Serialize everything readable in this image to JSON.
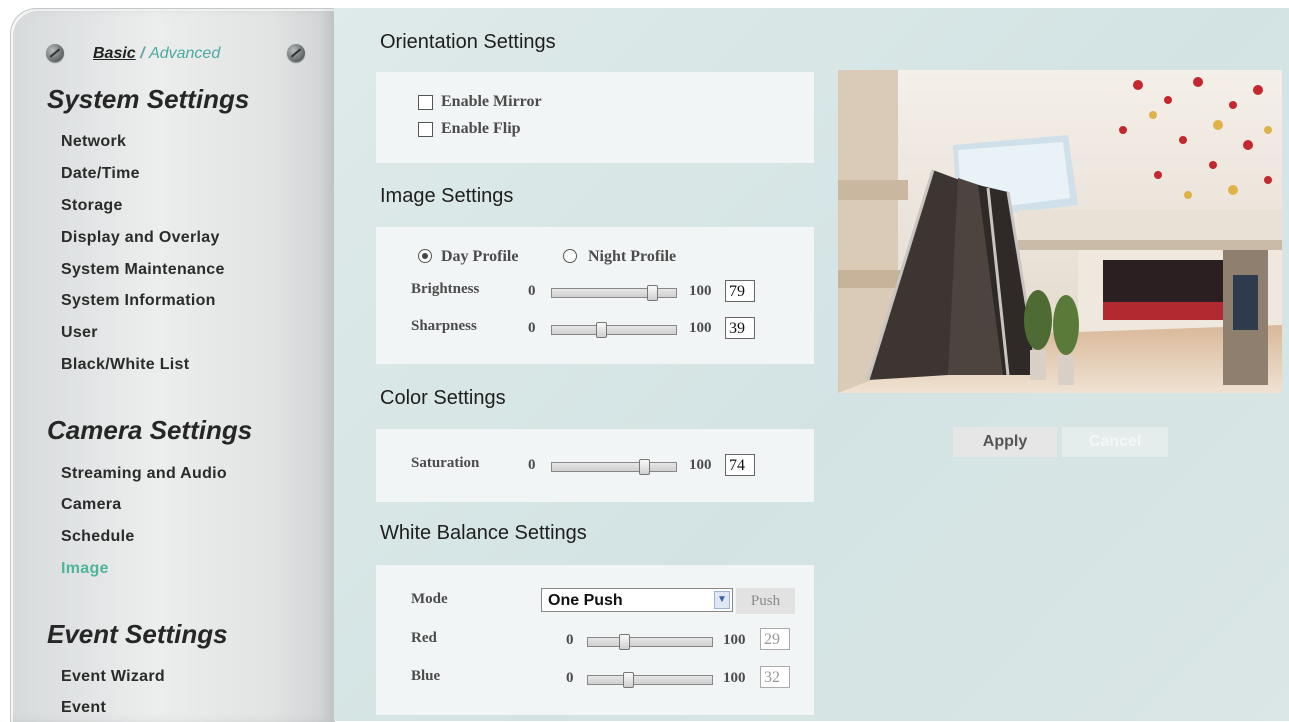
{
  "sidebar": {
    "mode_basic": "Basic",
    "mode_separator": "/",
    "mode_advanced": "Advanced",
    "system_settings": {
      "title": "System Settings",
      "items": [
        "Network",
        "Date/Time",
        "Storage",
        "Display and Overlay",
        "System Maintenance",
        "System Information",
        "User",
        "Black/White List"
      ]
    },
    "camera_settings": {
      "title": "Camera Settings",
      "items": [
        "Streaming and Audio",
        "Camera",
        "Schedule",
        "Image"
      ],
      "active": "Image"
    },
    "event_settings": {
      "title": "Event Settings",
      "items": [
        "Event Wizard",
        "Event"
      ]
    }
  },
  "orientation": {
    "title": "Orientation Settings",
    "enable_mirror": "Enable Mirror",
    "enable_mirror_checked": false,
    "enable_flip": "Enable Flip",
    "enable_flip_checked": false
  },
  "image": {
    "title": "Image Settings",
    "day_profile": "Day Profile",
    "night_profile": "Night Profile",
    "selected_profile": "Day Profile",
    "brightness": {
      "label": "Brightness",
      "min": "0",
      "max": "100",
      "value": "79"
    },
    "sharpness": {
      "label": "Sharpness",
      "min": "0",
      "max": "100",
      "value": "39"
    }
  },
  "color": {
    "title": "Color Settings",
    "saturation": {
      "label": "Saturation",
      "min": "0",
      "max": "100",
      "value": "74"
    }
  },
  "white_balance": {
    "title": "White Balance Settings",
    "mode_label": "Mode",
    "mode_value": "One Push",
    "push_label": "Push",
    "red": {
      "label": "Red",
      "min": "0",
      "max": "100",
      "value": "29"
    },
    "blue": {
      "label": "Blue",
      "min": "0",
      "max": "100",
      "value": "32"
    }
  },
  "actions": {
    "apply": "Apply",
    "cancel": "Cancel"
  },
  "colors": {
    "active_nav": "#4fb59a",
    "main_background": "#d8e6e6",
    "panel_background": "#f1f5f5"
  }
}
